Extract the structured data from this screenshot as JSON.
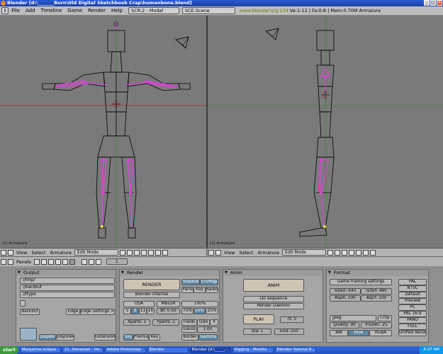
{
  "window": {
    "title": "Blender [d:\\_______Burn\\Old Digital Sketchbook Crap\\humanbone.blend]",
    "buttons": [
      "_",
      "□",
      "×"
    ]
  },
  "menubar": {
    "info_icon": "i",
    "items": [
      "File",
      "Add",
      "Timeline",
      "Game",
      "Render",
      "Help"
    ],
    "screen": "SCR:2 - Model",
    "scene": "SCE:Scene",
    "url": "www.blender.org 234",
    "stats": "Ve:1-12 | Fa:0-8 | Mem:0.70M Armature"
  },
  "viewports": {
    "left_label": "(1) Armature",
    "right_label": "(1) Armature"
  },
  "view_header": {
    "menus": [
      "View",
      "Select",
      "Armature"
    ],
    "mode": "Edit Mode"
  },
  "panels_bar": {
    "label": "Panels",
    "frame": "1"
  },
  "output": {
    "title": "Output",
    "paths": [
      "//tmp/",
      "//backbuf",
      "//ftype"
    ],
    "backbuf": "Backbuf",
    "edge": "Edge",
    "edge_settings": "Edge Settings >>",
    "dispwin": "DispWin",
    "dispview": "DispView",
    "extensions": "Extension"
  },
  "render": {
    "title": "Render",
    "render_btn": "RENDER",
    "engine": "Blender Internal",
    "shadow": "Shadow",
    "envmap": "EnvMap",
    "pano": "Pano",
    "ray": "Ray",
    "radio": "Radio",
    "osa": "OSA",
    "mblur": "MBLUR",
    "osa_levels": [
      "5",
      "8",
      "11",
      "16"
    ],
    "bf": "Bf: 0.50",
    "pct_100": "100%",
    "pct_75": "75%",
    "pct_50": "50%",
    "pct_25": "25%",
    "xparts": "Xparts: 1",
    "yparts": "Yparts: 1",
    "fields": "Fields",
    "odd": "Odd",
    "x": "X",
    "gauss": "Gauss",
    "gauss_val": "1.00",
    "sky": "Sky",
    "premul": "Premul",
    "key": "Key",
    "border": "Border",
    "gamma": "Gamma"
  },
  "anim": {
    "title": "Anim",
    "anim_btn": "ANIM",
    "do_sequence": "Do Sequence",
    "render_daemon": "Render Daemon",
    "play": "PLAY",
    "rt": "rt: 0",
    "sta": "Sta: 1",
    "end": "End: 250"
  },
  "format": {
    "title": "Format",
    "game_framing": "Game framing settings",
    "sizex": "SizeX: 640",
    "sizey": "SizeY: 480",
    "aspx": "AspX: 100",
    "aspy": "AspY: 100",
    "filetype": "Jpeg",
    "crop": "Crop",
    "quality": "Quality: 90",
    "fps": "Frs/sec: 25",
    "bw": "BW",
    "rgb": "RGB",
    "rgba": "RGBA",
    "presets": [
      "PAL",
      "NTSC",
      "Default",
      "Preview",
      "PC",
      "PAL 16:9",
      "PANO",
      "FULL",
      "Unified Render"
    ]
  },
  "taskbar": {
    "start": "start",
    "tasks": [
      "Margerine eclipse",
      "11. Stereolab - De...",
      "Adobe Photoshop",
      "Blender",
      "Blender [d:\\_____...",
      "Rigging - Mozilla",
      "Blender Tutorial 8..."
    ],
    "clock": "4:27 AM"
  },
  "colors": {
    "viewport_bg": "#7a7a7a",
    "bone_pink": "#e040e0",
    "grid": "#6e6e6e",
    "red_axis": "#b03030",
    "green_axis": "#3a8a3a"
  }
}
